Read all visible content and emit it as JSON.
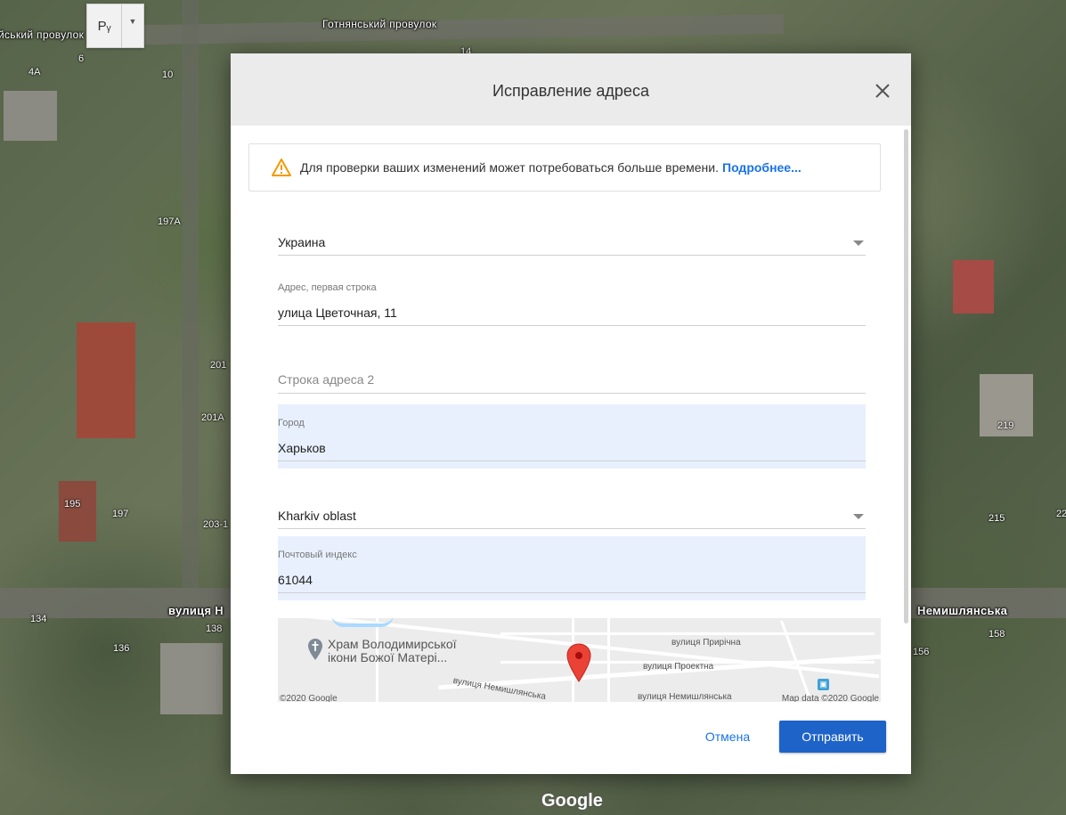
{
  "map": {
    "lang_button": "Рᵧ",
    "streets": {
      "top": "Готнянський провулок",
      "left_top": "йський провулок",
      "main_left": "вулиця Н",
      "main_right": "Немишлянська"
    },
    "house_numbers": [
      "4А",
      "6",
      "10",
      "14",
      "197А",
      "201",
      "201А",
      "195",
      "197",
      "203-1",
      "134",
      "138",
      "136",
      "219",
      "215",
      "22",
      "158",
      "156"
    ],
    "attribution": "Google"
  },
  "dialog": {
    "title": "Исправление адреса",
    "warning": {
      "text": "Для проверки ваших изменений может потребоваться больше времени.",
      "link": "Подробнее..."
    },
    "country": {
      "value": "Украина"
    },
    "address1": {
      "label": "Адрес, первая строка",
      "value": "улица Цветочная, 11"
    },
    "address2": {
      "placeholder": "Строка адреса 2"
    },
    "city": {
      "label": "Город",
      "value": "Харьков"
    },
    "region": {
      "value": "Kharkiv oblast"
    },
    "postal": {
      "label": "Почтовый индекс",
      "value": "61044"
    },
    "mini_map": {
      "poi": "Храм Володимирської іконі Божої Матері...",
      "poi_line1": "Храм Володимирської",
      "poi_line2": "ікони Божої Матері...",
      "street1": "вулиця Прирічна",
      "street2": "вулиця Проектна",
      "street3": "вулиця Немишлянська",
      "street4": "вулиця Немишлянська",
      "copyright_left": "©2020 Google",
      "copyright_right": "Map data ©2020 Google"
    },
    "buttons": {
      "cancel": "Отмена",
      "submit": "Отправить"
    }
  },
  "colors": {
    "accent": "#1a73e8",
    "submit_bg": "#1e63c8",
    "filled_bg": "#e8f0fe",
    "warning": "#f29900",
    "pin": "#ea4335"
  }
}
